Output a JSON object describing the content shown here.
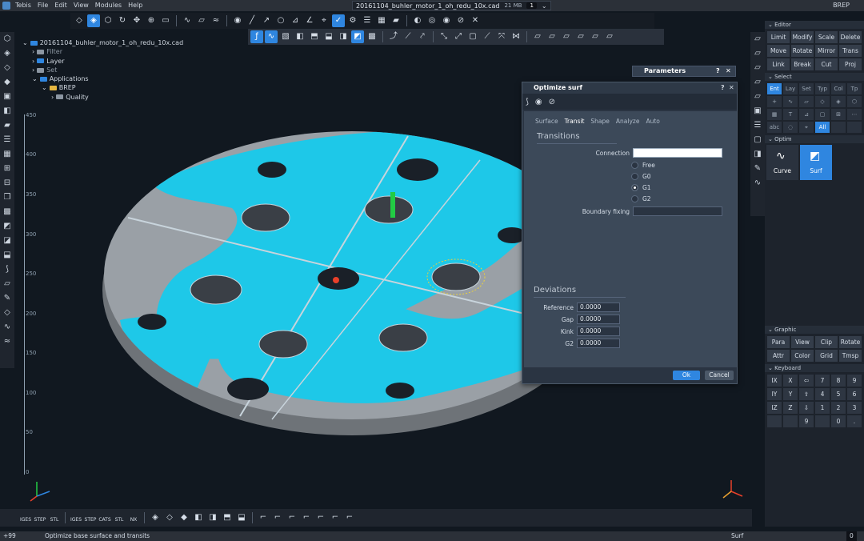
{
  "menubar": {
    "app_name": "Tebis",
    "items": [
      "File",
      "Edit",
      "View",
      "Modules",
      "Help"
    ],
    "file_tab": "20161104_buhler_motor_1_oh_redu_10x.cad",
    "file_size": "21 MB",
    "tab_count": "1",
    "mode": "BREP"
  },
  "tree": {
    "root": "20161104_buhler_motor_1_oh_redu_10x.cad",
    "items": [
      {
        "label": "Filter"
      },
      {
        "label": "Layer"
      },
      {
        "label": "Set"
      },
      {
        "label": "Applications"
      },
      {
        "label": "BREP"
      },
      {
        "label": "Quality"
      }
    ]
  },
  "axis": {
    "labels": [
      "450",
      "400",
      "350",
      "300",
      "250",
      "200",
      "150",
      "100",
      "50",
      "0"
    ]
  },
  "parameters": {
    "title": "Parameters"
  },
  "dialog": {
    "title": "Optimize surf",
    "tabs": [
      "Surface",
      "Transit",
      "Shape",
      "Analyze",
      "Auto"
    ],
    "transitions_title": "Transitions",
    "connection_label": "Connection",
    "connection_value": "",
    "radios": [
      {
        "label": "Free",
        "selected": false
      },
      {
        "label": "G0",
        "selected": false
      },
      {
        "label": "G1",
        "selected": true
      },
      {
        "label": "G2",
        "selected": false
      }
    ],
    "boundary_label": "Boundary fixing",
    "boundary_value": "",
    "deviations_title": "Deviations",
    "deviations": [
      {
        "label": "Reference",
        "value": "0.0000"
      },
      {
        "label": "Gap",
        "value": "0.0000"
      },
      {
        "label": "Kink",
        "value": "0.0000"
      },
      {
        "label": "G2",
        "value": "0.0000"
      }
    ],
    "ok": "Ok",
    "cancel": "Cancel"
  },
  "right_panel": {
    "editor_title": "Editor",
    "editor_buttons": [
      "Limit",
      "Modify",
      "Scale",
      "Delete",
      "Move",
      "Rotate",
      "Mirror",
      "Trans",
      "Link",
      "Break",
      "Cut",
      "Proj"
    ],
    "select_title": "Select",
    "select_tabs": [
      "Ent",
      "Lay",
      "Set",
      "Typ",
      "Col",
      "Tp"
    ],
    "select_all": "All",
    "optim_title": "Optim",
    "optim_buttons": [
      "Curve",
      "Surf"
    ],
    "graphic_title": "Graphic",
    "graphic_buttons": [
      "Para",
      "View",
      "Clip",
      "Rotate",
      "Attr",
      "Color",
      "Grid",
      "Tmsp"
    ],
    "keyboard_title": "Keyboard",
    "keyboard_keys": [
      "IX",
      "X",
      "⇦",
      "7",
      "8",
      "9",
      "IY",
      "Y",
      "⇧",
      "4",
      "5",
      "6",
      "IZ",
      "Z",
      "⇩",
      "1",
      "2",
      "3",
      "",
      "",
      "9",
      "",
      "0",
      "."
    ]
  },
  "bottombar": {
    "labels": [
      "IGES",
      "STEP",
      "STL",
      "IGES",
      "STEP",
      "CATS",
      "STL",
      "NX"
    ]
  },
  "status": {
    "left_code": "+99",
    "message": "Optimize base surface and transits",
    "mode": "Surf",
    "count": "0"
  },
  "colors": {
    "accent": "#2f86e0",
    "surface_cyan": "#1ec8e8",
    "part_grey": "#9aa0a6",
    "background": "#111820"
  }
}
